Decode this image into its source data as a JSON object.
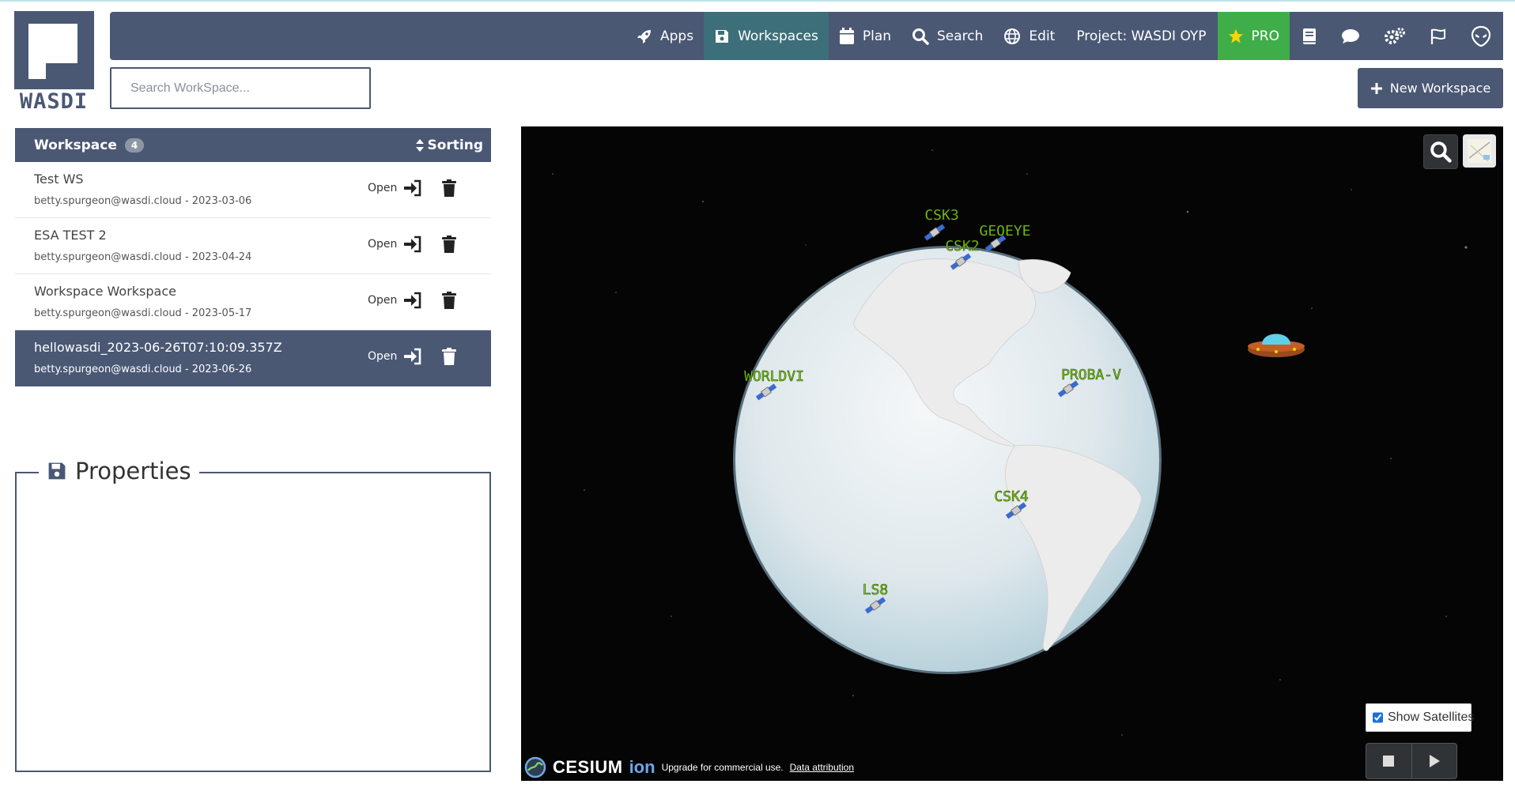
{
  "logo": {
    "text": "WASDI"
  },
  "navbar": {
    "items": [
      {
        "label": "Apps",
        "icon": "rocket-icon"
      },
      {
        "label": "Workspaces",
        "icon": "floppy-disk-icon",
        "active": true
      },
      {
        "label": "Plan",
        "icon": "calendar-icon"
      },
      {
        "label": "Search",
        "icon": "search-icon"
      },
      {
        "label": "Edit",
        "icon": "globe-icon"
      }
    ],
    "project_label": "Project: WASDI OYP",
    "pro_label": "PRO",
    "right_icons": [
      "book-icon",
      "chat-icon",
      "settings-icon",
      "flag-icon",
      "alien-icon"
    ]
  },
  "search": {
    "placeholder": "Search WorkSpace..."
  },
  "new_workspace_label": "New Workspace",
  "workspace_list": {
    "header": "Workspace",
    "count": "4",
    "sorting_label": "Sorting",
    "open_label": "Open",
    "rows": [
      {
        "name": "Test WS",
        "meta": "betty.spurgeon@wasdi.cloud - 2023-03-06"
      },
      {
        "name": "ESA TEST 2",
        "meta": "betty.spurgeon@wasdi.cloud - 2023-04-24"
      },
      {
        "name": "Workspace Workspace",
        "meta": "betty.spurgeon@wasdi.cloud - 2023-05-17"
      },
      {
        "name": "hellowasdi_2023-06-26T07:10:09.357Z",
        "meta": "betty.spurgeon@wasdi.cloud - 2023-06-26",
        "selected": true
      }
    ]
  },
  "properties": {
    "title": "Properties"
  },
  "globe": {
    "satellites": [
      "CSK3",
      "GEOEYE",
      "CSK2",
      "WORLDVI",
      "PROBA-V",
      "CSK4",
      "LS8"
    ],
    "label_color": "#7fd21a",
    "show_satellites_label": "Show Satellites",
    "show_satellites_checked": true,
    "credits": {
      "brand": "CESIUM",
      "ion": "ion",
      "notice": "Upgrade for commercial use.",
      "attribution": "Data attribution"
    }
  },
  "colors": {
    "navbar": "#4a5874",
    "active": "#3c6f79",
    "pro": "#3fae49"
  }
}
